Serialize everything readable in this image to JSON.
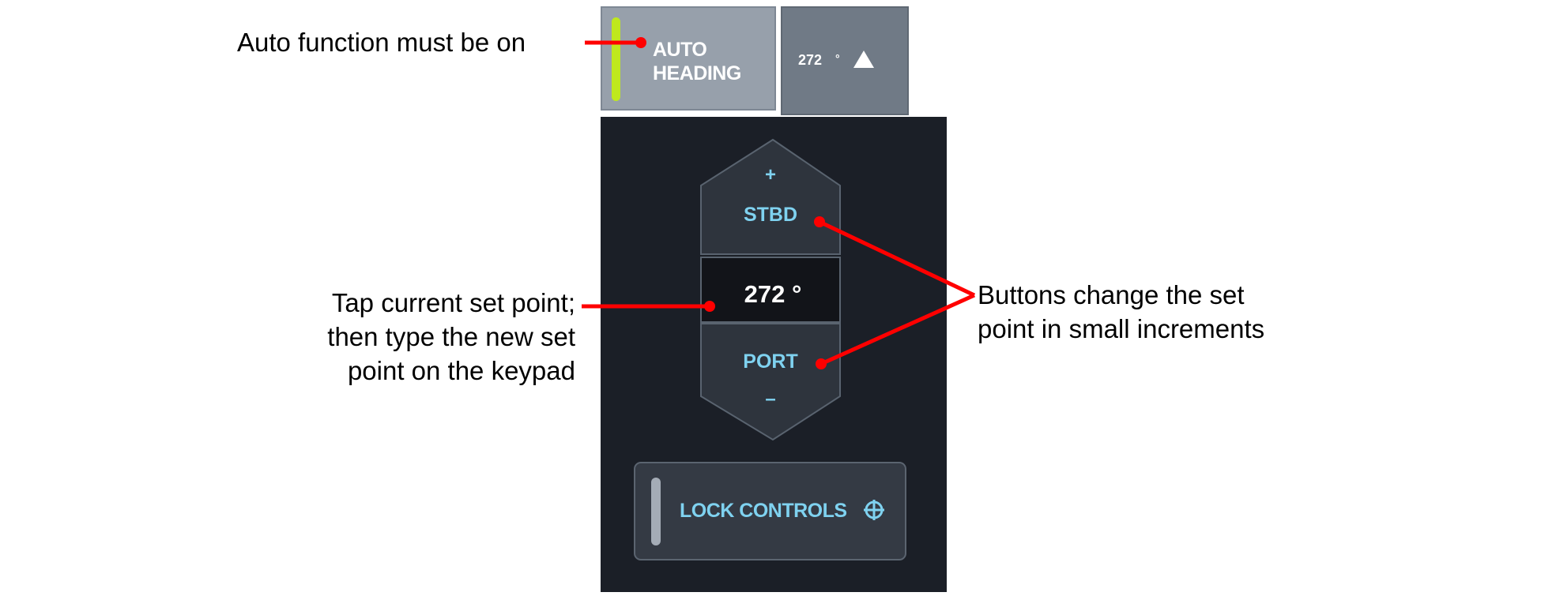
{
  "annotations": {
    "auto_note": "Auto function must be on",
    "setpoint_note_line1": "Tap current set point;",
    "setpoint_note_line2": "then type the new set",
    "setpoint_note_line3": "point on the keypad",
    "buttons_note_line1": "Buttons change the set",
    "buttons_note_line2": "point in small increments"
  },
  "top_bar": {
    "auto_heading_line1": "AUTO",
    "auto_heading_line2": "HEADING",
    "heading_value": "272",
    "heading_degree": "°"
  },
  "control": {
    "plus": "+",
    "stbd": "STBD",
    "setpoint": "272 °",
    "port": "PORT",
    "minus": "–",
    "lock_label": "LOCK CONTROLS"
  },
  "icons": {
    "caret": "caret-up-icon",
    "crosshair": "crosshair-icon"
  },
  "colors": {
    "accent_cyan": "#7fd2f0",
    "indicator_green": "#bfe81d",
    "leader_red": "#ff0000",
    "panel_dark": "#1b1f27"
  }
}
